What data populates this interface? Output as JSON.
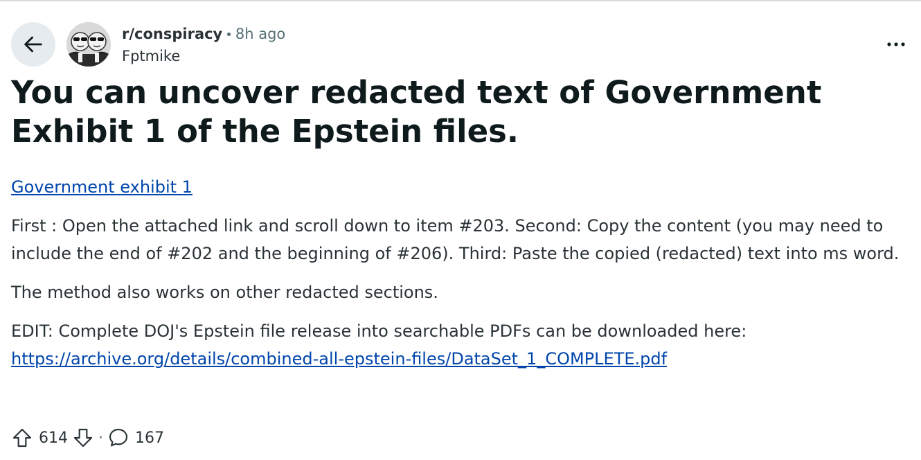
{
  "post": {
    "subreddit": "r/conspiracy",
    "separator": "•",
    "time_ago": "8h ago",
    "author": "Fptmike",
    "title": "You can uncover redacted text of Government Exhibit 1 of the Epstein files.",
    "link_text": "Government exhibit 1",
    "paragraph1": "First : Open the attached link and scroll down to item #203. Second: Copy the content (you may need to include the end of #202 and the beginning of #206). Third: Paste the copied (redacted) text into ms word.",
    "paragraph2": "The method also works on other redacted sections.",
    "paragraph3_text": "EDIT: Complete DOJ's Epstein file release into searchable PDFs can be downloaded here: ",
    "paragraph3_link": "https://archive.org/details/combined-all-epstein-files/DataSet_1_COMPLETE.pdf"
  },
  "actions": {
    "upvotes": "614",
    "dot": "·",
    "comments": "167"
  },
  "icons": {
    "back": "arrow-left-icon",
    "more": "more-horizontal-icon",
    "upvote": "upvote-arrow-icon",
    "downvote": "downvote-arrow-icon",
    "comment": "comment-bubble-icon"
  }
}
